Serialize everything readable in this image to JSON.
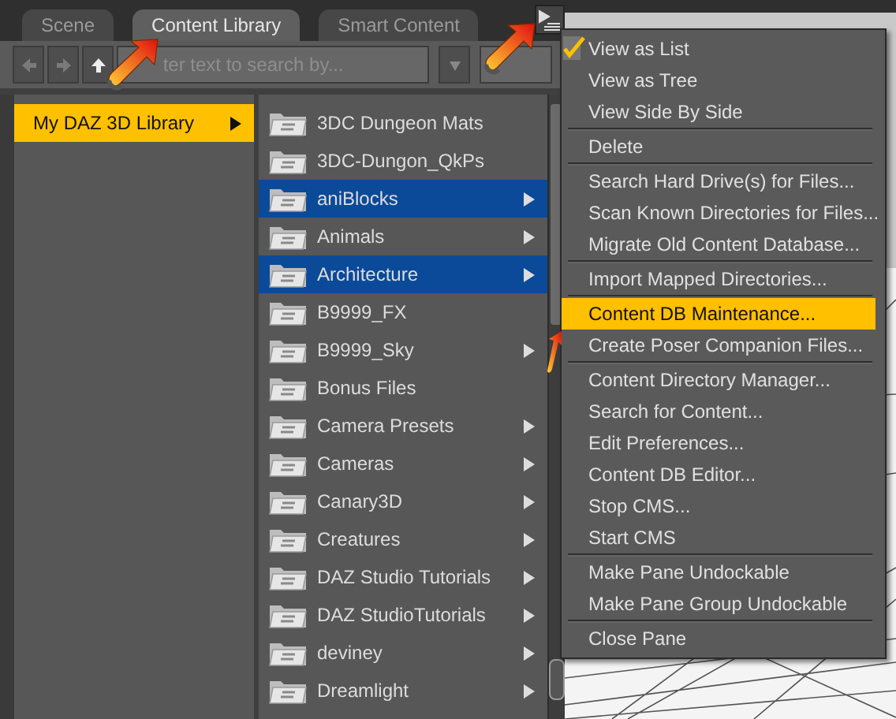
{
  "tabs": [
    {
      "label": "Scene",
      "selected": false
    },
    {
      "label": "Content Library",
      "selected": true
    },
    {
      "label": "Smart Content",
      "selected": false
    }
  ],
  "search": {
    "placeholder": "ter text to search by..."
  },
  "sidebar": {
    "items": [
      {
        "label": "My DAZ 3D Library",
        "selected": true,
        "has_submenu": true
      }
    ]
  },
  "folders": [
    {
      "label": "3DC Dungeon Mats",
      "selected": false,
      "has_submenu": false
    },
    {
      "label": "3DC-Dungon_QkPs",
      "selected": false,
      "has_submenu": false
    },
    {
      "label": "aniBlocks",
      "selected": true,
      "has_submenu": true
    },
    {
      "label": "Animals",
      "selected": false,
      "has_submenu": true
    },
    {
      "label": "Architecture",
      "selected": true,
      "has_submenu": true
    },
    {
      "label": "B9999_FX",
      "selected": false,
      "has_submenu": false
    },
    {
      "label": "B9999_Sky",
      "selected": false,
      "has_submenu": true
    },
    {
      "label": "Bonus Files",
      "selected": false,
      "has_submenu": false
    },
    {
      "label": "Camera Presets",
      "selected": false,
      "has_submenu": true
    },
    {
      "label": "Cameras",
      "selected": false,
      "has_submenu": true
    },
    {
      "label": "Canary3D",
      "selected": false,
      "has_submenu": true
    },
    {
      "label": "Creatures",
      "selected": false,
      "has_submenu": true
    },
    {
      "label": "DAZ Studio Tutorials",
      "selected": false,
      "has_submenu": true
    },
    {
      "label": "DAZ StudioTutorials",
      "selected": false,
      "has_submenu": true
    },
    {
      "label": "deviney",
      "selected": false,
      "has_submenu": true
    },
    {
      "label": "Dreamlight",
      "selected": false,
      "has_submenu": true
    }
  ],
  "context_menu": {
    "items": [
      {
        "kind": "item",
        "label": "View as List",
        "checked": true,
        "selected": false
      },
      {
        "kind": "item",
        "label": "View as Tree",
        "checked": false,
        "selected": false
      },
      {
        "kind": "item",
        "label": "View Side By Side",
        "checked": false,
        "selected": false
      },
      {
        "kind": "separator"
      },
      {
        "kind": "item",
        "label": "Delete",
        "checked": false,
        "selected": false
      },
      {
        "kind": "separator"
      },
      {
        "kind": "item",
        "label": "Search Hard Drive(s) for Files...",
        "checked": false,
        "selected": false
      },
      {
        "kind": "item",
        "label": "Scan Known Directories for Files...",
        "checked": false,
        "selected": false
      },
      {
        "kind": "item",
        "label": "Migrate Old Content Database...",
        "checked": false,
        "selected": false
      },
      {
        "kind": "separator"
      },
      {
        "kind": "item",
        "label": "Import Mapped Directories...",
        "checked": false,
        "selected": false
      },
      {
        "kind": "separator"
      },
      {
        "kind": "item",
        "label": "Content DB Maintenance...",
        "checked": false,
        "selected": true
      },
      {
        "kind": "item",
        "label": "Create Poser Companion Files...",
        "checked": false,
        "selected": false
      },
      {
        "kind": "separator"
      },
      {
        "kind": "item",
        "label": "Content Directory Manager...",
        "checked": false,
        "selected": false
      },
      {
        "kind": "item",
        "label": "Search for Content...",
        "checked": false,
        "selected": false
      },
      {
        "kind": "item",
        "label": "Edit Preferences...",
        "checked": false,
        "selected": false
      },
      {
        "kind": "item",
        "label": "Content DB Editor...",
        "checked": false,
        "selected": false
      },
      {
        "kind": "item",
        "label": "Stop CMS...",
        "checked": false,
        "selected": false
      },
      {
        "kind": "item",
        "label": "Start CMS",
        "checked": false,
        "selected": false
      },
      {
        "kind": "separator"
      },
      {
        "kind": "item",
        "label": "Make Pane Undockable",
        "checked": false,
        "selected": false
      },
      {
        "kind": "item",
        "label": "Make Pane Group Undockable",
        "checked": false,
        "selected": false
      },
      {
        "kind": "separator"
      },
      {
        "kind": "item",
        "label": "Close Pane",
        "checked": false,
        "selected": false
      }
    ]
  }
}
